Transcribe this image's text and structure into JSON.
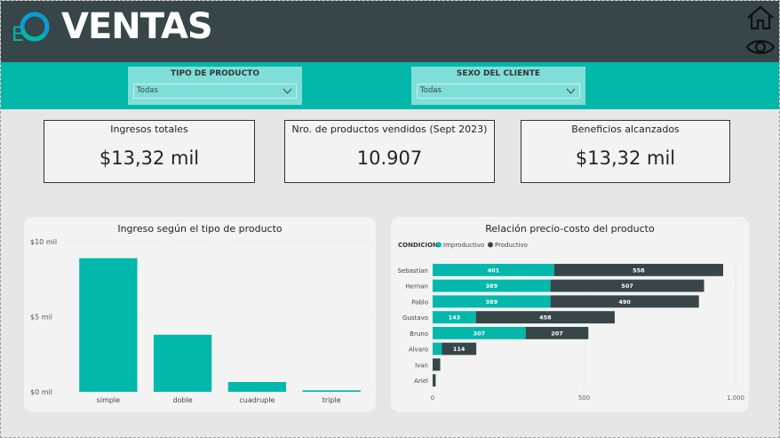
{
  "header": {
    "logo_text": "E",
    "title": "VENTAS"
  },
  "icons": {
    "home": "home-icon",
    "view": "eye-icon"
  },
  "filters": {
    "tipo": {
      "label": "TIPO DE PRODUCTO",
      "value": "Todas"
    },
    "sexo": {
      "label": "SEXO DEL CLIENTE",
      "value": "Todas"
    }
  },
  "kpis": [
    {
      "title": "Ingresos totales",
      "value": "$13,32 mil"
    },
    {
      "title": "Nro. de productos vendidos (Sept 2023)",
      "value": "10.907"
    },
    {
      "title": "Beneficios alcanzados",
      "value": "$13,32 mil"
    }
  ],
  "colors": {
    "teal": "#01b8aa",
    "dark": "#374649",
    "header_bg": "#374649"
  },
  "chart_data": [
    {
      "type": "bar",
      "title": "Ingreso según el tipo de producto",
      "categories": [
        "simple",
        "doble",
        "cuadruple",
        "triple"
      ],
      "values": [
        8.9,
        3.8,
        0.65,
        0.1
      ],
      "ylim": [
        0,
        10
      ],
      "yticks": [
        {
          "value": 0,
          "label": "$0 mil"
        },
        {
          "value": 5,
          "label": "$5 mil"
        },
        {
          "value": 10,
          "label": "$10 mil"
        }
      ],
      "color": "#01b8aa",
      "grid": true
    },
    {
      "type": "bar",
      "orientation": "horizontal",
      "stacked": true,
      "title": "Relación precio-costo del producto",
      "legend_title": "CONDICION",
      "legend_position": "top-left",
      "categories": [
        "Sebastian",
        "Hernan",
        "Pablo",
        "Gustavo",
        "Bruno",
        "Alvaro",
        "Ivan",
        "Ariel"
      ],
      "series": [
        {
          "name": "Improductivo",
          "color": "#01b8aa",
          "values": [
            401,
            389,
            389,
            143,
            307,
            30,
            0,
            0
          ]
        },
        {
          "name": "Productivo",
          "color": "#374649",
          "values": [
            558,
            507,
            490,
            458,
            207,
            114,
            25,
            10
          ]
        }
      ],
      "labels_shown": [
        [
          "401",
          "389",
          "389",
          "143",
          "307",
          "",
          "",
          ""
        ],
        [
          "558",
          "507",
          "490",
          "458",
          "207",
          "114",
          "",
          ""
        ]
      ],
      "xlim": [
        0,
        1000
      ],
      "xticks": [
        {
          "value": 0,
          "label": "0"
        },
        {
          "value": 500,
          "label": "500"
        },
        {
          "value": 1000,
          "label": "1.000"
        }
      ],
      "grid": true
    }
  ]
}
